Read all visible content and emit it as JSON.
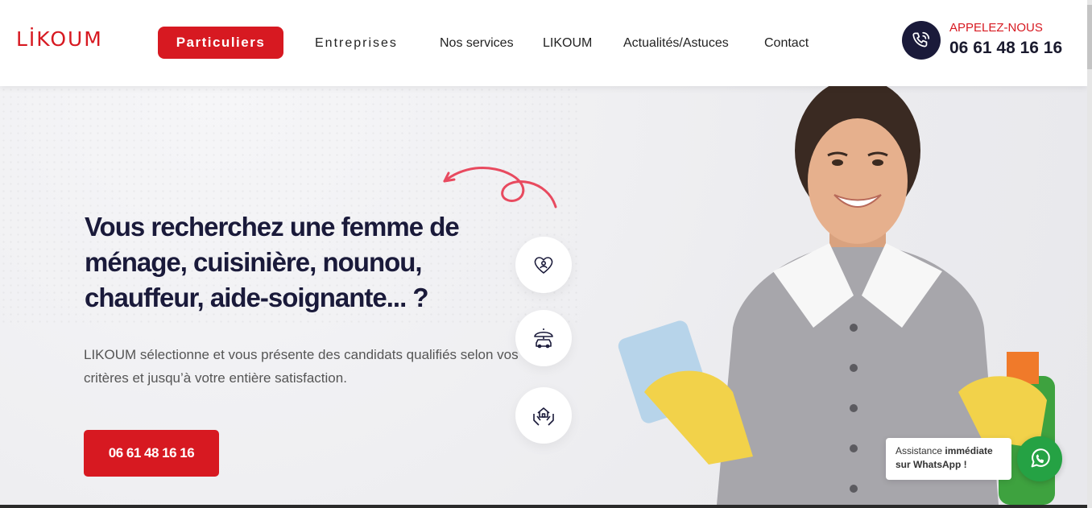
{
  "header": {
    "logo": "LİKOUM",
    "nav": {
      "particuliers": "Particuliers",
      "entreprises": "Entreprises",
      "services": "Nos services",
      "likoum": "LIKOUM",
      "actualites": "Actualités/Astuces",
      "contact": "Contact"
    },
    "call": {
      "label": "APPELEZ-NOUS",
      "number": "06 61 48 16 16",
      "icon": "phone-icon"
    }
  },
  "hero": {
    "headline": "Vous recherchez une femme de ménage, cuisinière, nounou, chauffeur, aide-soignante... ?",
    "subtext": "LIKOUM sélectionne et vous présente des candidats qualifiés selon vos critères et jusqu’à votre entière satisfaction.",
    "cta": "06 61 48 16 16",
    "icons": [
      "heart-hands-icon",
      "car-umbrella-icon",
      "house-hands-icon"
    ]
  },
  "whatsapp": {
    "text_prefix": "Assistance ",
    "text_bold": "immédiate sur WhatsApp !",
    "icon": "whatsapp-icon"
  },
  "colors": {
    "brand_red": "#d71921",
    "navy": "#1a1a3a",
    "whatsapp_green": "#25a244"
  }
}
